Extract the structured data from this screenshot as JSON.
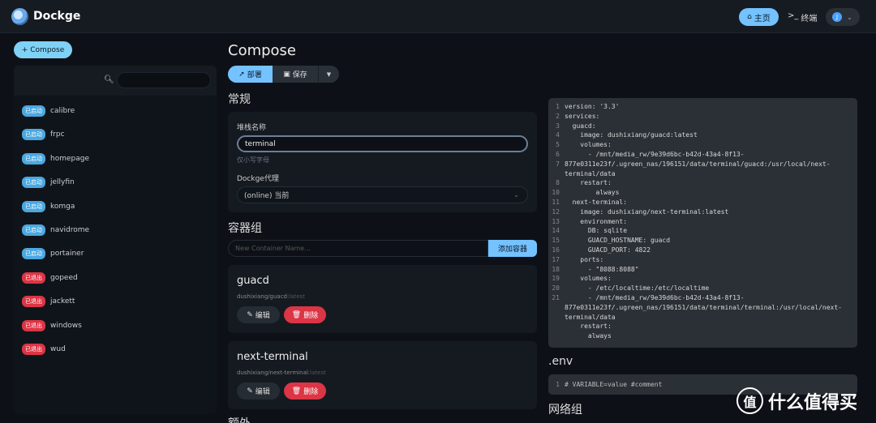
{
  "header": {
    "brand": "Dockge",
    "home_label": "主页",
    "terminal_label": "终端",
    "user_initial": "J"
  },
  "sidebar": {
    "compose_label": "Compose",
    "stacks": [
      {
        "status": "已启动",
        "state": "running",
        "name": "calibre"
      },
      {
        "status": "已启动",
        "state": "running",
        "name": "frpc"
      },
      {
        "status": "已启动",
        "state": "running",
        "name": "homepage"
      },
      {
        "status": "已启动",
        "state": "running",
        "name": "jellyfin"
      },
      {
        "status": "已启动",
        "state": "running",
        "name": "komga"
      },
      {
        "status": "已启动",
        "state": "running",
        "name": "navidrome"
      },
      {
        "status": "已启动",
        "state": "running",
        "name": "portainer"
      },
      {
        "status": "已退出",
        "state": "exited",
        "name": "gopeed"
      },
      {
        "status": "已退出",
        "state": "exited",
        "name": "jackett"
      },
      {
        "status": "已退出",
        "state": "exited",
        "name": "windows"
      },
      {
        "status": "已退出",
        "state": "exited",
        "name": "wud"
      }
    ]
  },
  "main": {
    "title": "Compose",
    "deploy_label": "部署",
    "save_label": "保存",
    "general_heading": "常规",
    "stack_name_label": "堆栈名称",
    "stack_name_value": "terminal",
    "stack_name_hint": "仅小写字母",
    "agent_label": "Dockge代理",
    "agent_value": "(online) 当前",
    "containers_heading": "容器组",
    "container_placeholder": "New Container Name...",
    "add_container_label": "添加容器",
    "containers": [
      {
        "name": "guacd",
        "image": "dushixiang/guacd:",
        "tag": "latest",
        "edit": "编辑",
        "delete": "删除"
      },
      {
        "name": "next-terminal",
        "image": "dushixiang/next-terminal:",
        "tag": "latest",
        "edit": "编辑",
        "delete": "删除"
      }
    ],
    "extra_heading": "额外"
  },
  "editor": {
    "lines": [
      {
        "n": "1",
        "t": "version: '3.3'"
      },
      {
        "n": "2",
        "t": "services:"
      },
      {
        "n": "3",
        "t": "  guacd:"
      },
      {
        "n": "4",
        "t": "    image: dushixiang/guacd:latest"
      },
      {
        "n": "5",
        "t": "    volumes:"
      },
      {
        "n": "6",
        "t": "      - /mnt/media_rw/9e39d6bc-b42d-43a4-8f13-"
      },
      {
        "n": "7",
        "t": "877e0311e23f/.ugreen_nas/196151/data/terminal/guacd:/usr/local/next-"
      },
      {
        "n": "",
        "t": "terminal/data"
      },
      {
        "n": "8",
        "t": "    restart:"
      },
      {
        "n": "10",
        "t": "        always"
      },
      {
        "n": "11",
        "t": "  next-terminal:"
      },
      {
        "n": "12",
        "t": "    image: dushixiang/next-terminal:latest"
      },
      {
        "n": "13",
        "t": "    environment:"
      },
      {
        "n": "14",
        "t": "      DB: sqlite"
      },
      {
        "n": "15",
        "t": "      GUACD_HOSTNAME: guacd"
      },
      {
        "n": "16",
        "t": "      GUACD_PORT: 4822"
      },
      {
        "n": "17",
        "t": "    ports:"
      },
      {
        "n": "18",
        "t": "      - \"8088:8088\""
      },
      {
        "n": "19",
        "t": "    volumes:"
      },
      {
        "n": "20",
        "t": "      - /etc/localtime:/etc/localtime"
      },
      {
        "n": "21",
        "t": "      - /mnt/media_rw/9e39d6bc-b42d-43a4-8f13-"
      },
      {
        "n": "",
        "t": "877e0311e23f/.ugreen_nas/196151/data/terminal/terminal:/usr/local/next-"
      },
      {
        "n": "",
        "t": "terminal/data"
      },
      {
        "n": "",
        "t": "    restart:"
      },
      {
        "n": "",
        "t": "      always"
      }
    ],
    "env_heading": ".env",
    "env_line_num": "1",
    "env_line": "# VARIABLE=value #comment",
    "network_heading": "网络组"
  },
  "watermark": {
    "symbol": "值",
    "text": "什么值得买"
  }
}
